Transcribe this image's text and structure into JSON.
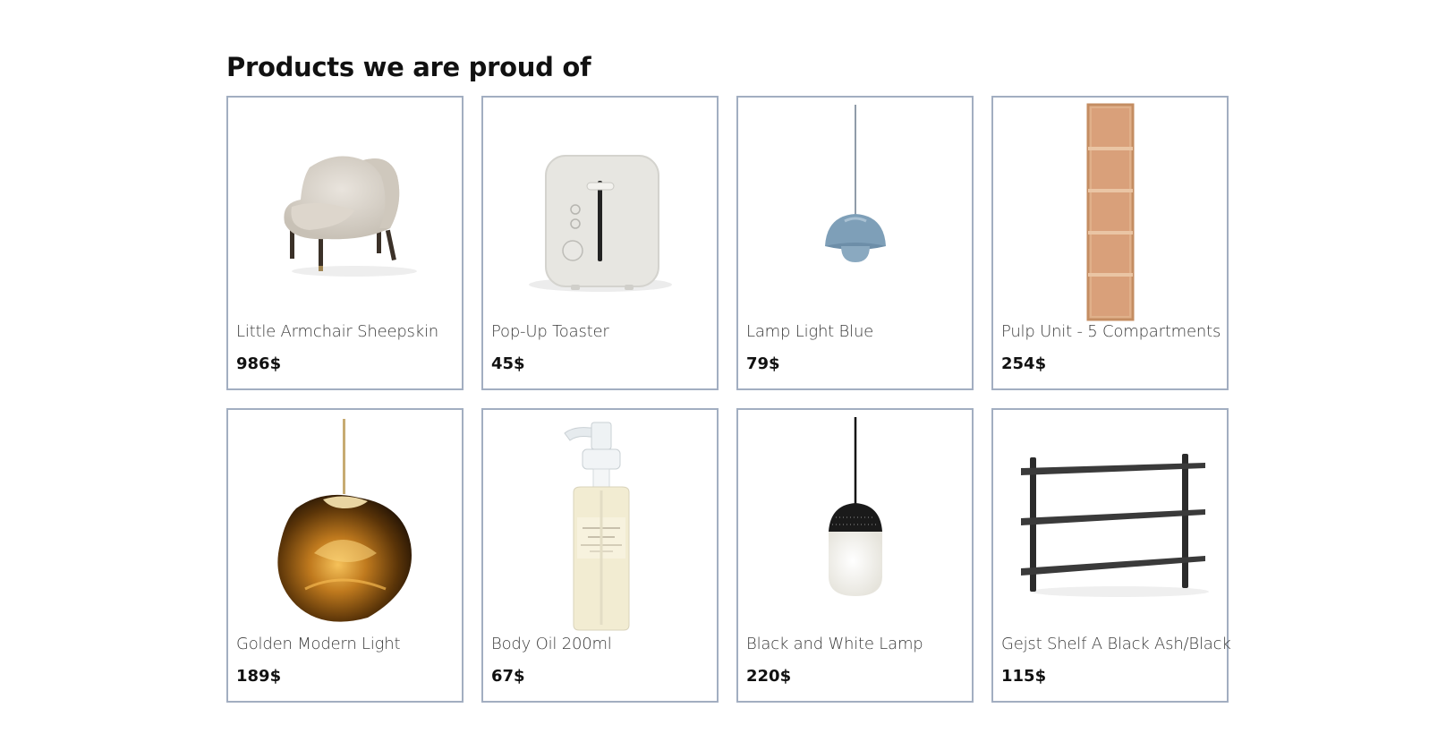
{
  "section": {
    "title": "Products we are proud of"
  },
  "products": [
    {
      "name": "Little Armchair Sheepskin",
      "price": "986$",
      "icon": "armchair-icon"
    },
    {
      "name": "Pop-Up Toaster",
      "price": "45$",
      "icon": "toaster-icon"
    },
    {
      "name": "Lamp Light Blue",
      "price": "79$",
      "icon": "pendant-lamp-blue-icon"
    },
    {
      "name": "Pulp Unit - 5 Compartments",
      "price": "254$",
      "icon": "shelf-unit-icon"
    },
    {
      "name": "Golden Modern Light",
      "price": "189$",
      "icon": "golden-lamp-icon"
    },
    {
      "name": "Body Oil 200ml",
      "price": "67$",
      "icon": "oil-bottle-icon"
    },
    {
      "name": "Black and White Lamp",
      "price": "220$",
      "icon": "black-white-lamp-icon"
    },
    {
      "name": "Gejst Shelf A Black Ash/Black",
      "price": "115$",
      "icon": "wall-shelf-icon"
    }
  ],
  "colors": {
    "card_border": "#a2aec1",
    "title": "#111111",
    "name": "#3a3a3a"
  }
}
